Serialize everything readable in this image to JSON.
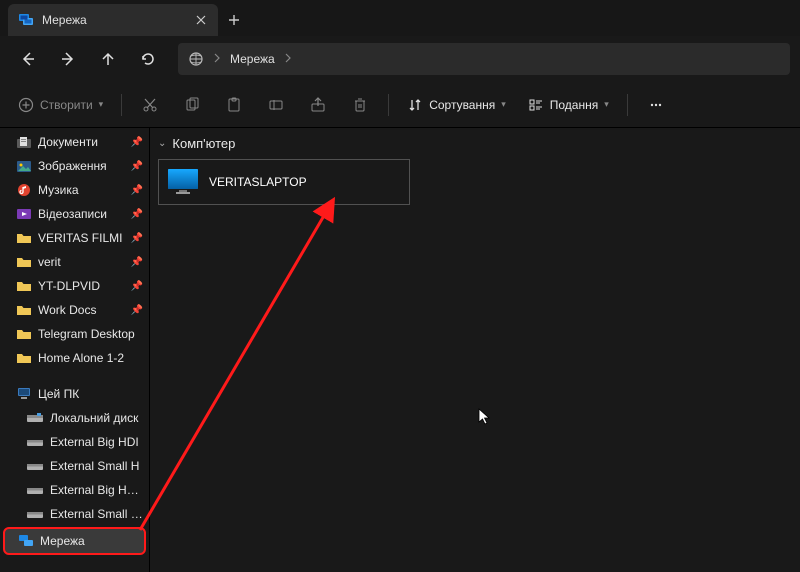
{
  "tab": {
    "title": "Мережа"
  },
  "address": {
    "crumb1": "Мережа"
  },
  "toolbar": {
    "create": "Створити",
    "sort": "Сортування",
    "view": "Подання"
  },
  "sidebar": {
    "quick": [
      {
        "label": "Документи",
        "icon": "docs",
        "pinned": true
      },
      {
        "label": "Зображення",
        "icon": "pictures",
        "pinned": true
      },
      {
        "label": "Музика",
        "icon": "music",
        "pinned": true
      },
      {
        "label": "Відеозаписи",
        "icon": "videos",
        "pinned": true
      },
      {
        "label": "VERITAS FILMI",
        "icon": "folder",
        "pinned": true
      },
      {
        "label": "verit",
        "icon": "folder",
        "pinned": true
      },
      {
        "label": "YT-DLPVID",
        "icon": "folder",
        "pinned": true
      },
      {
        "label": "Work Docs",
        "icon": "folder",
        "pinned": true
      },
      {
        "label": "Telegram Desktop",
        "icon": "folder",
        "pinned": false
      },
      {
        "label": "Home Alone 1-2",
        "icon": "folder",
        "pinned": false
      }
    ],
    "thispc": {
      "label": "Цей ПК"
    },
    "drives": [
      {
        "label": "Локальний диск"
      },
      {
        "label": "External Big HDI"
      },
      {
        "label": "External Small H"
      },
      {
        "label": "External Big HDD"
      },
      {
        "label": "External Small HD"
      }
    ],
    "network": {
      "label": "Мережа"
    }
  },
  "content": {
    "group": "Комп'ютер",
    "computer": "VERITASLAPTOP"
  },
  "colors": {
    "accent_red": "#ff1a1a",
    "folder_yellow": "#f0c756",
    "monitor_blue": "#0a84d8"
  }
}
